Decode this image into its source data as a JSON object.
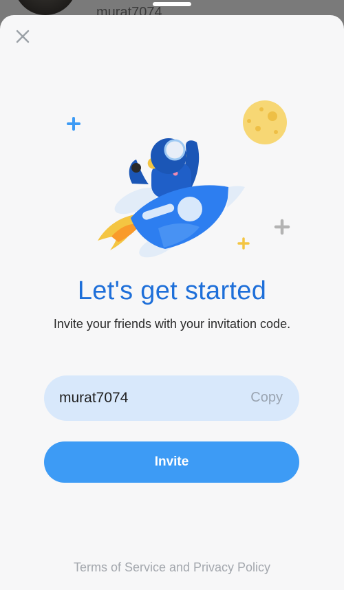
{
  "background": {
    "username": "murat7074"
  },
  "sheet": {
    "close_icon": "close-icon",
    "illustration": "astronaut-rocket-illustration",
    "title": "Let's get started",
    "subtitle": "Invite your friends with your invitation code.",
    "code": {
      "value": "murat7074",
      "copy_label": "Copy"
    },
    "invite_label": "Invite",
    "terms_label": "Terms of Service and Privacy Policy"
  },
  "colors": {
    "accent": "#3d9bf5",
    "title": "#1e6fd9",
    "code_bg": "#d8e8fb",
    "moon": "#f7d774"
  }
}
